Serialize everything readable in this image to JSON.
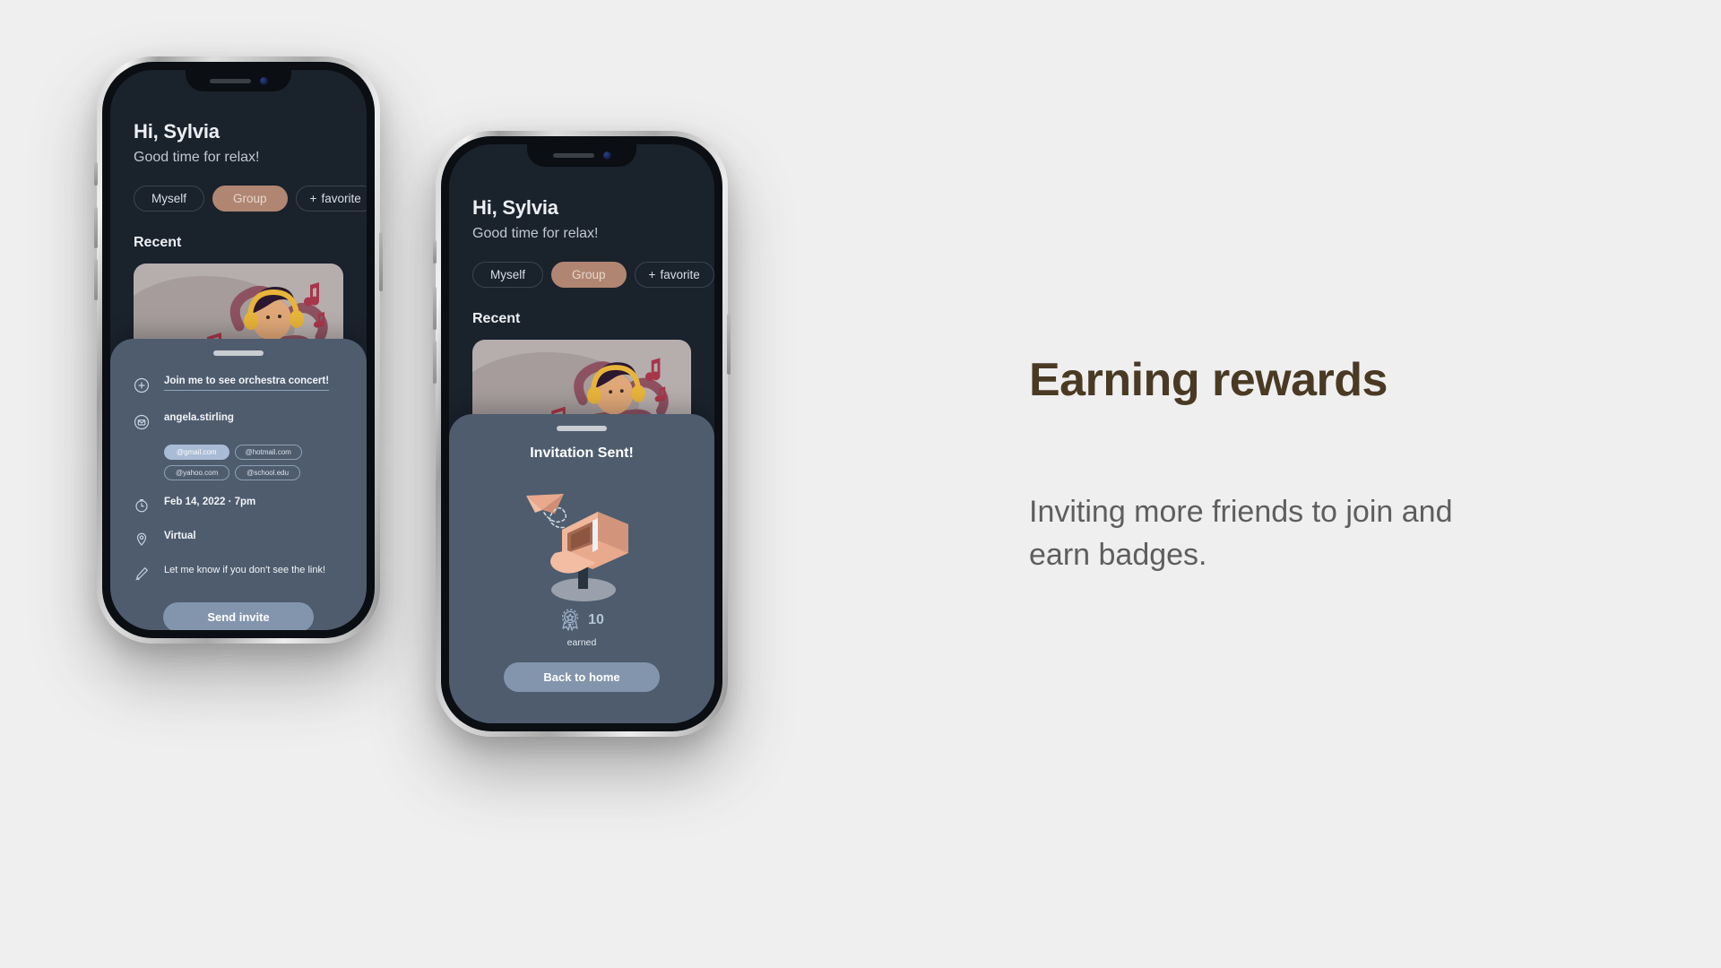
{
  "page": {
    "background": "#efefef"
  },
  "panel": {
    "heading": "Earning rewards",
    "body": "Inviting more friends to join and earn badges.",
    "heading_color": "#4a3a24",
    "body_color": "#5e5e5e"
  },
  "app": {
    "greeting": "Hi, Sylvia",
    "subtitle": "Good time for relax!",
    "section_recent": "Recent",
    "filters": [
      {
        "label": "Myself",
        "active": false,
        "icon": null
      },
      {
        "label": "Group",
        "active": true,
        "icon": null
      },
      {
        "label": "favorite",
        "active": false,
        "icon": "plus-icon"
      }
    ],
    "accent_chip_color": "#b08672",
    "screen_background": "#1a222c",
    "sheet_background": "#4e5c6e"
  },
  "phone1": {
    "sheet": {
      "title_field": {
        "icon": "plus-circle-icon",
        "value": "Join me to see orchestra concert!"
      },
      "email_field": {
        "icon": "envelope-icon",
        "value": "angela.stirling"
      },
      "domain_chips": [
        {
          "label": "@gmail.com",
          "selected": true
        },
        {
          "label": "@hotmail.com",
          "selected": false
        },
        {
          "label": "@yahoo.com",
          "selected": false
        },
        {
          "label": "@school.edu",
          "selected": false
        }
      ],
      "datetime_field": {
        "icon": "clock-icon",
        "value": "Feb 14, 2022 · 7pm"
      },
      "location_field": {
        "icon": "pin-icon",
        "value": "Virtual"
      },
      "note_field": {
        "icon": "pencil-icon",
        "value": "Let me know if you don't see the link!"
      },
      "submit_label": "Send invite",
      "submit_color": "#8395ad"
    }
  },
  "phone2": {
    "sheet": {
      "title": "Invitation Sent!",
      "illustration": "mailbox-with-paper-plane",
      "reward": {
        "icon": "badge-icon",
        "count": "10",
        "caption": "earned"
      },
      "button_label": "Back to home",
      "button_color": "#8395ad"
    }
  }
}
